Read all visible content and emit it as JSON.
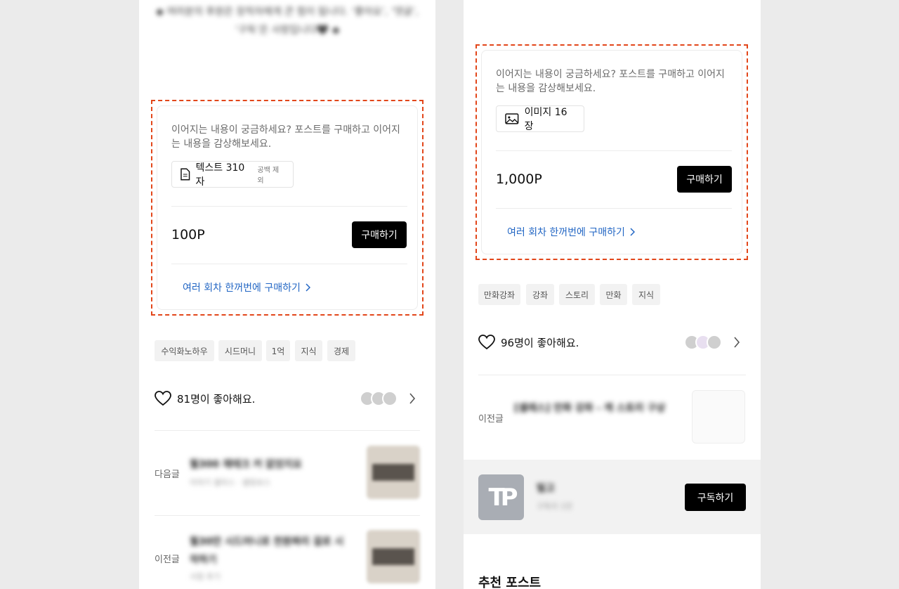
{
  "left": {
    "blurred_intro": "◆ 여러분의 후원은 창작자에게 큰 힘이 됩니다. ‘좋아요’, ‘댓글’, ‘구독’은 사랑입니다🖤 ◆",
    "purchase": {
      "description": "이어지는 내용이 궁금하세요? 포스트를 구매하고 이어지는 내용을 감상해보세요.",
      "chip_icon": "document-icon",
      "chip_label": "텍스트 310자",
      "chip_sub": "공백 제외",
      "price": "100P",
      "buy_label": "구매하기",
      "bulk_link": "여러 회차 한꺼번에 구매하기"
    },
    "tags": [
      "수익화노하우",
      "시드머니",
      "1억",
      "지식",
      "경제"
    ],
    "likes_text": "81명이 좋아해요.",
    "next_label": "다음글",
    "prev_label": "이전글",
    "next_title": "월300 재테크 커 없었지요",
    "next_sub": "이야기 셀라스 · 셀링보스",
    "prev_title": "월30만 시드머니로 천원짜리 걸로 시작하기",
    "prev_sub": "서점 후기"
  },
  "right": {
    "purchase": {
      "description": "이어지는 내용이 궁금하세요? 포스트를 구매하고 이어지는 내용을 감상해보세요.",
      "chip_icon": "image-icon",
      "chip_label": "이미지 16장",
      "price": "1,000P",
      "buy_label": "구매하기",
      "bulk_link": "여러 회차 한꺼번에 구매하기"
    },
    "tags": [
      "만화강좌",
      "강좌",
      "스토리",
      "만화",
      "지식"
    ],
    "likes_text": "96명이 좋아해요.",
    "prev_label": "이전글",
    "prev_title": "[셀레스] 만화 강좌 - 캐 스토리 구상",
    "creator_name": "빌고",
    "creator_sub": "구독자 1만",
    "subscribe_label": "구독하기",
    "logo_text": "TP",
    "recommend_title": "추천 포스트"
  },
  "colors": {
    "accent_red": "#e2461a",
    "link_blue": "#2266c4",
    "button_black": "#000000"
  }
}
